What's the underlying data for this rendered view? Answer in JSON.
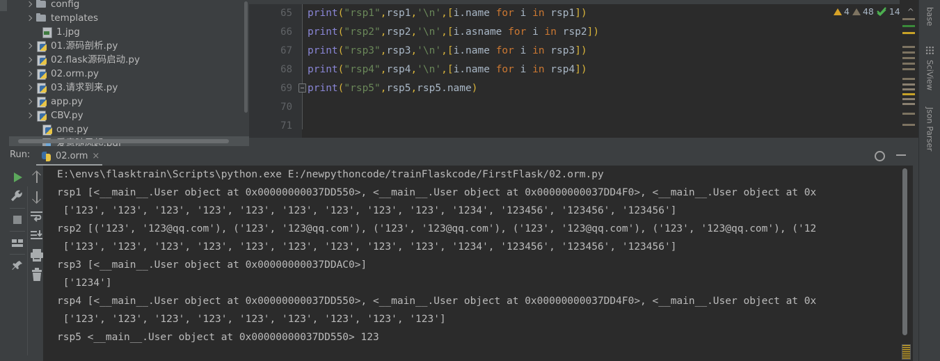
{
  "project_tree": {
    "items": [
      {
        "label": "config",
        "icon": "folder-icon",
        "expandable": true,
        "indent": 1
      },
      {
        "label": "templates",
        "icon": "folder-icon",
        "expandable": true,
        "indent": 1
      },
      {
        "label": "1.jpg",
        "icon": "image-file-icon",
        "expandable": false,
        "indent": 2
      },
      {
        "label": "01.源码剖析.py",
        "icon": "python-file-icon",
        "expandable": true,
        "indent": 1
      },
      {
        "label": "02.flask源码启动.py",
        "icon": "python-file-icon",
        "expandable": true,
        "indent": 1
      },
      {
        "label": "02.orm.py",
        "icon": "python-file-icon",
        "expandable": true,
        "indent": 1
      },
      {
        "label": "03.请求到来.py",
        "icon": "python-file-icon",
        "expandable": true,
        "indent": 1
      },
      {
        "label": "app.py",
        "icon": "python-file-icon",
        "expandable": true,
        "indent": 1
      },
      {
        "label": "CBV.py",
        "icon": "python-file-icon",
        "expandable": true,
        "indent": 1
      },
      {
        "label": "one.py",
        "icon": "python-file-icon",
        "expandable": false,
        "indent": 2
      },
      {
        "label": "爱意随风起.pdf",
        "icon": "pdf-file-icon",
        "expandable": false,
        "indent": 2,
        "selected": true
      }
    ]
  },
  "editor": {
    "line_numbers": [
      "65",
      "66",
      "67",
      "68",
      "69",
      "70",
      "71"
    ],
    "lines": [
      {
        "n": "65",
        "tokens": [
          {
            "t": "        ",
            "c": "plain"
          },
          {
            "t": "print",
            "c": "fn"
          },
          {
            "t": "(",
            "c": "par"
          },
          {
            "t": "\"rsp1\"",
            "c": "str"
          },
          {
            "t": ",",
            "c": "par"
          },
          {
            "t": "rsp1",
            "c": "var"
          },
          {
            "t": ",",
            "c": "par"
          },
          {
            "t": "'\\n'",
            "c": "str"
          },
          {
            "t": ",",
            "c": "par"
          },
          {
            "t": "[",
            "c": "brk"
          },
          {
            "t": "i",
            "c": "var"
          },
          {
            "t": ".name ",
            "c": "var"
          },
          {
            "t": "for",
            "c": "kw"
          },
          {
            "t": " i ",
            "c": "var"
          },
          {
            "t": "in",
            "c": "kw"
          },
          {
            "t": " rsp1",
            "c": "var"
          },
          {
            "t": "]",
            "c": "brk"
          },
          {
            "t": ")",
            "c": "par"
          }
        ]
      },
      {
        "n": "66",
        "tokens": [
          {
            "t": "        ",
            "c": "plain"
          },
          {
            "t": "print",
            "c": "fn"
          },
          {
            "t": "(",
            "c": "par"
          },
          {
            "t": "\"rsp2\"",
            "c": "str"
          },
          {
            "t": ",",
            "c": "par"
          },
          {
            "t": "rsp2",
            "c": "var"
          },
          {
            "t": ",",
            "c": "par"
          },
          {
            "t": "'\\n'",
            "c": "str"
          },
          {
            "t": ",",
            "c": "par"
          },
          {
            "t": "[",
            "c": "brk"
          },
          {
            "t": "i",
            "c": "var"
          },
          {
            "t": ".asname ",
            "c": "var"
          },
          {
            "t": "for",
            "c": "kw"
          },
          {
            "t": " i ",
            "c": "var"
          },
          {
            "t": "in",
            "c": "kw"
          },
          {
            "t": " rsp2",
            "c": "var"
          },
          {
            "t": "]",
            "c": "brk"
          },
          {
            "t": ")",
            "c": "par"
          }
        ]
      },
      {
        "n": "67",
        "tokens": [
          {
            "t": "        ",
            "c": "plain"
          },
          {
            "t": "print",
            "c": "fn"
          },
          {
            "t": "(",
            "c": "par"
          },
          {
            "t": "\"rsp3\"",
            "c": "str"
          },
          {
            "t": ",",
            "c": "par"
          },
          {
            "t": "rsp3",
            "c": "var"
          },
          {
            "t": ",",
            "c": "par"
          },
          {
            "t": "'\\n'",
            "c": "str"
          },
          {
            "t": ",",
            "c": "par"
          },
          {
            "t": "[",
            "c": "brk"
          },
          {
            "t": "i",
            "c": "var"
          },
          {
            "t": ".name ",
            "c": "var"
          },
          {
            "t": "for",
            "c": "kw"
          },
          {
            "t": " i ",
            "c": "var"
          },
          {
            "t": "in",
            "c": "kw"
          },
          {
            "t": " rsp3",
            "c": "var"
          },
          {
            "t": "]",
            "c": "brk"
          },
          {
            "t": ")",
            "c": "par"
          }
        ]
      },
      {
        "n": "68",
        "tokens": [
          {
            "t": "        ",
            "c": "plain"
          },
          {
            "t": "print",
            "c": "fn"
          },
          {
            "t": "(",
            "c": "par"
          },
          {
            "t": "\"rsp4\"",
            "c": "str"
          },
          {
            "t": ",",
            "c": "par"
          },
          {
            "t": "rsp4",
            "c": "var"
          },
          {
            "t": ",",
            "c": "par"
          },
          {
            "t": "'\\n'",
            "c": "str"
          },
          {
            "t": ",",
            "c": "par"
          },
          {
            "t": "[",
            "c": "brk"
          },
          {
            "t": "i",
            "c": "var"
          },
          {
            "t": ".name ",
            "c": "var"
          },
          {
            "t": "for",
            "c": "kw"
          },
          {
            "t": " i ",
            "c": "var"
          },
          {
            "t": "in",
            "c": "kw"
          },
          {
            "t": " rsp4",
            "c": "var"
          },
          {
            "t": "]",
            "c": "brk"
          },
          {
            "t": ")",
            "c": "par"
          }
        ]
      },
      {
        "n": "69",
        "tokens": [
          {
            "t": "        ",
            "c": "plain"
          },
          {
            "t": "print",
            "c": "fn"
          },
          {
            "t": "(",
            "c": "par"
          },
          {
            "t": "\"rsp5\"",
            "c": "str"
          },
          {
            "t": ",",
            "c": "par"
          },
          {
            "t": "rsp5",
            "c": "var"
          },
          {
            "t": ",",
            "c": "par"
          },
          {
            "t": "rsp5.name",
            "c": "var"
          },
          {
            "t": ")",
            "c": "par"
          }
        ]
      },
      {
        "n": "70",
        "tokens": []
      },
      {
        "n": "71",
        "tokens": []
      }
    ],
    "inspection": {
      "warnings_count": "4",
      "weak_warnings_count": "48",
      "typos_count": "14",
      "prev_label": "^",
      "next_label": "v"
    }
  },
  "right_toolwindows": {
    "items": [
      {
        "label": "base",
        "icon": ""
      },
      {
        "label": "SciView",
        "icon": "grid-icon"
      },
      {
        "label": "Json Parser",
        "icon": ""
      }
    ]
  },
  "run_panel": {
    "title": "Run:",
    "tab_label": "02.orm",
    "tab_close": "×",
    "settings_icon": "gear-icon",
    "minimize_icon": "minimize-icon",
    "left_tools": [
      {
        "name": "rerun-button",
        "icon": "play-icon"
      },
      {
        "name": "edit-configurations-button",
        "icon": "wrench-icon"
      },
      {
        "name": "stop-button",
        "icon": "stop-icon"
      },
      {
        "name": "layout-button",
        "icon": "layout-icon"
      },
      {
        "name": "pin-tab-button",
        "icon": "pin-icon"
      }
    ],
    "right_tools": [
      {
        "name": "up-stack-button",
        "icon": "arrow-up-icon"
      },
      {
        "name": "down-stack-button",
        "icon": "arrow-down-icon"
      },
      {
        "name": "soft-wrap-button",
        "icon": "soft-wrap-icon"
      },
      {
        "name": "scroll-to-end-button",
        "icon": "scroll-end-icon"
      },
      {
        "name": "print-button",
        "icon": "print-icon"
      },
      {
        "name": "clear-all-button",
        "icon": "trash-icon"
      }
    ],
    "console_lines": [
      "E:\\envs\\flasktrain\\Scripts\\python.exe E:/newpythoncode/trainFlaskcode/FirstFlask/02.orm.py",
      "rsp1 [<__main__.User object at 0x00000000037DD550>, <__main__.User object at 0x00000000037DD4F0>, <__main__.User object at 0x",
      " ['123', '123', '123', '123', '123', '123', '123', '123', '123', '1234', '123456', '123456', '123456']",
      "rsp2 [('123', '123@qq.com'), ('123', '123@qq.com'), ('123', '123@qq.com'), ('123', '123@qq.com'), ('123', '123@qq.com'), ('12",
      " ['123', '123', '123', '123', '123', '123', '123', '123', '123', '1234', '123456', '123456', '123456']",
      "rsp3 [<__main__.User object at 0x00000000037DDAC0>]",
      " ['1234']",
      "rsp4 [<__main__.User object at 0x00000000037DD550>, <__main__.User object at 0x00000000037DD4F0>, <__main__.User object at 0x",
      " ['123', '123', '123', '123', '123', '123', '123', '123', '123']",
      "rsp5 <__main__.User object at 0x00000000037DD550> 123"
    ]
  },
  "colors": {
    "panel_bg": "#3c3f41",
    "editor_bg": "#2b2b2b",
    "gutter_bg": "#313335",
    "text": "#bbbbbb",
    "string": "#6a8759",
    "keyword": "#cc7832",
    "function": "#8a86d6",
    "bracket": "#d9b43a",
    "warning": "#d6a227",
    "ok_green": "#5ca85c"
  }
}
